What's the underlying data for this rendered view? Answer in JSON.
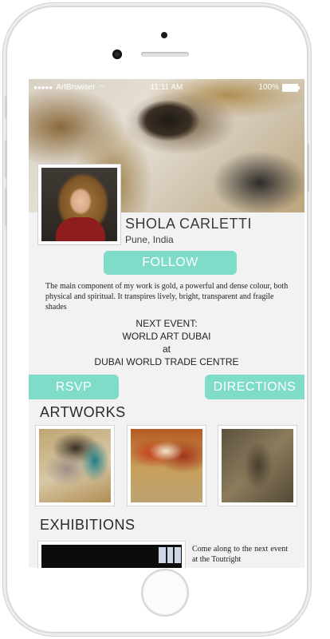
{
  "status_bar": {
    "carrier": "ArtBrowser",
    "time": "11:11 AM",
    "battery": "100%"
  },
  "artist": {
    "name": "SHOLA CARLETTI",
    "location": "Pune, India"
  },
  "follow_label": "FOLLOW",
  "bio": "The main component of my work is gold, a powerful and dense colour, both physical and spiritual. It transpires lively, bright, transparent and fragile shades",
  "event": {
    "heading": "NEXT EVENT:",
    "name": "WORLD ART DUBAI",
    "connector": "at",
    "venue": "DUBAI WORLD TRADE CENTRE"
  },
  "rsvp_label": "RSVP",
  "directions_label": "DIRECTIONS",
  "sections": {
    "artworks": "ARTWORKS",
    "exhibitions": "EXHIBITIONS"
  },
  "exhibition_text": "Come along to the next event at the Toutright",
  "colors": {
    "accent": "#7fdcc9"
  }
}
